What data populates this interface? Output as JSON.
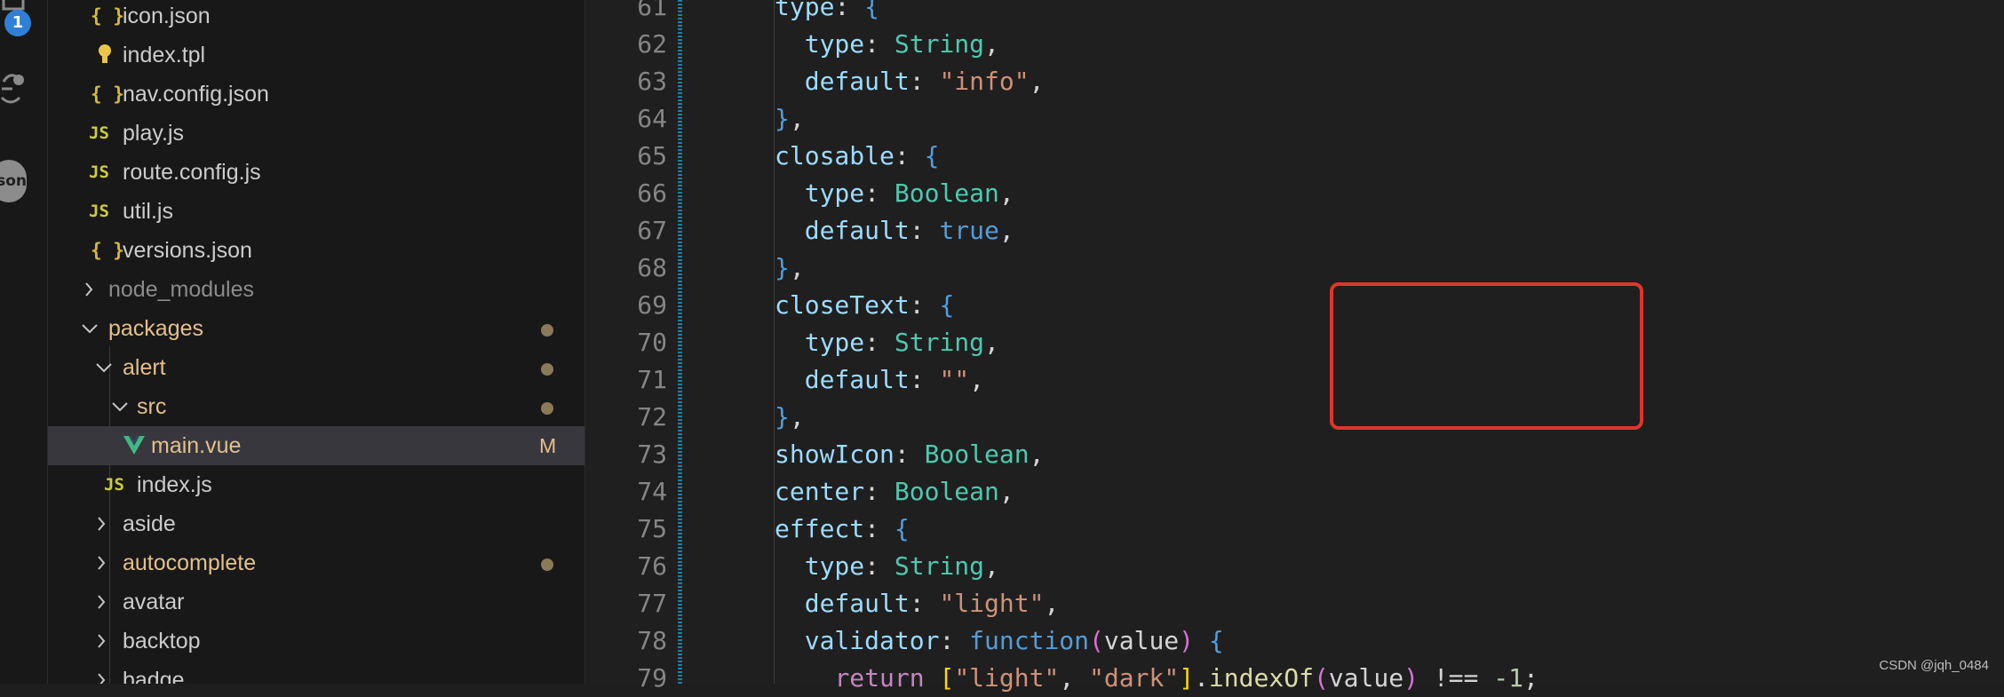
{
  "activity_bar": {
    "source_control_badge": "1",
    "account_label": "son"
  },
  "explorer": {
    "items": [
      {
        "label": "icon.json",
        "icon": "json-braces-icon",
        "kind": "file"
      },
      {
        "label": "index.tpl",
        "icon": "lightbulb-icon",
        "kind": "file"
      },
      {
        "label": "nav.config.json",
        "icon": "json-braces-icon",
        "kind": "file"
      },
      {
        "label": "play.js",
        "icon": "js-file-icon",
        "kind": "file"
      },
      {
        "label": "route.config.js",
        "icon": "js-file-icon",
        "kind": "file"
      },
      {
        "label": "util.js",
        "icon": "js-file-icon",
        "kind": "file"
      },
      {
        "label": "versions.json",
        "icon": "json-braces-icon",
        "kind": "file"
      },
      {
        "label": "node_modules",
        "icon": "chevron-right-icon",
        "kind": "folder-collapsed"
      },
      {
        "label": "packages",
        "icon": "chevron-down-icon",
        "kind": "folder-expanded",
        "modified": true
      },
      {
        "label": "alert",
        "icon": "chevron-down-icon",
        "kind": "folder-expanded",
        "modified": true
      },
      {
        "label": "src",
        "icon": "chevron-down-icon",
        "kind": "folder-expanded",
        "modified": true
      },
      {
        "label": "main.vue",
        "icon": "vue-file-icon",
        "kind": "file",
        "status": "M",
        "selected": true
      },
      {
        "label": "index.js",
        "icon": "js-file-icon",
        "kind": "file"
      },
      {
        "label": "aside",
        "icon": "chevron-right-icon",
        "kind": "folder-collapsed"
      },
      {
        "label": "autocomplete",
        "icon": "chevron-right-icon",
        "kind": "folder-collapsed",
        "modified": true
      },
      {
        "label": "avatar",
        "icon": "chevron-right-icon",
        "kind": "folder-collapsed"
      },
      {
        "label": "backtop",
        "icon": "chevron-right-icon",
        "kind": "folder-collapsed"
      },
      {
        "label": "badge",
        "icon": "chevron-right-icon",
        "kind": "folder-collapsed"
      }
    ],
    "icon_glyphs": {
      "json": "{ }",
      "js": "JS",
      "chev_right": "›",
      "chev_down": "⌄"
    }
  },
  "editor": {
    "line_numbers": [
      "61",
      "62",
      "63",
      "64",
      "65",
      "66",
      "67",
      "68",
      "69",
      "70",
      "71",
      "72",
      "73",
      "74",
      "75",
      "76",
      "77",
      "78",
      "79"
    ],
    "lines": [
      "type: {",
      "  type: String,",
      "  default: \"info\",",
      "},",
      "closable: {",
      "  type: Boolean,",
      "  default: true,",
      "},",
      "closeText: {",
      "  type: String,",
      "  default: \"\",",
      "},",
      "showIcon: Boolean,",
      "center: Boolean,",
      "effect: {",
      "  type: String,",
      "  default: \"light\",",
      "  validator: function(value) {",
      "    return [\"light\", \"dark\"].indexOf(value) !== -1;"
    ],
    "highlight_color": "#e0352b"
  },
  "watermark": "CSDN @jqh_0484"
}
